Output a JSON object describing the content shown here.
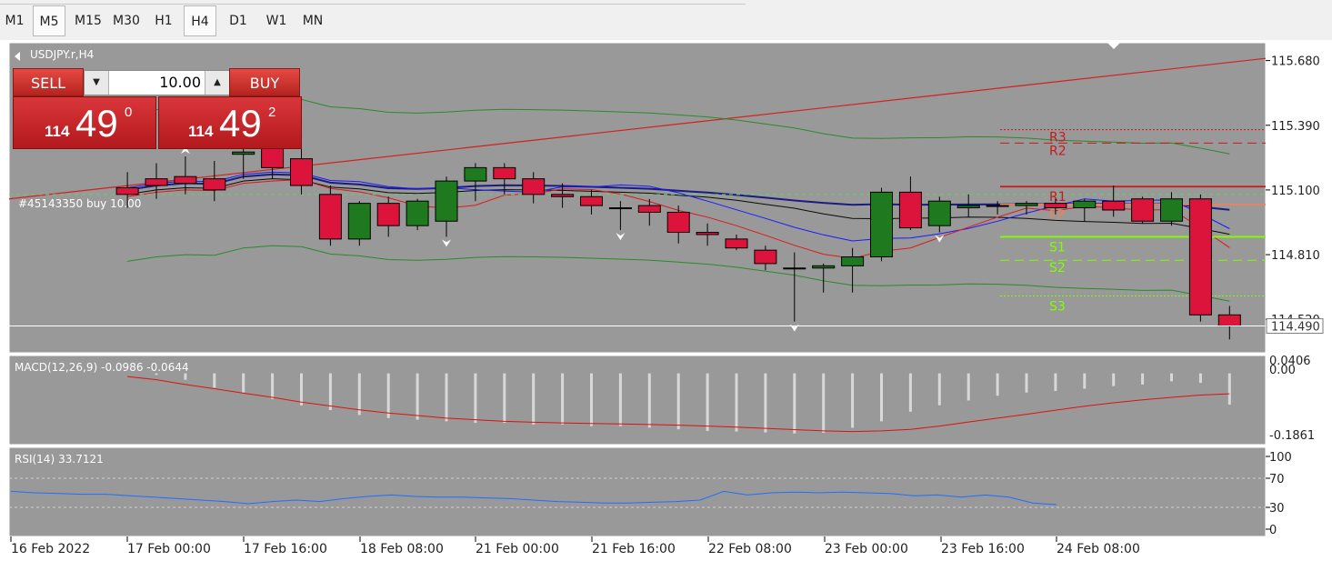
{
  "timeframes": [
    "M1",
    "M5",
    "M15",
    "M30",
    "H1",
    "H4",
    "D1",
    "W1",
    "MN"
  ],
  "selected_timeframes": [
    "M5",
    "H4"
  ],
  "symbol_label": "USDJPY.r,H4",
  "trade_panel": {
    "sell_label": "SELL",
    "buy_label": "BUY",
    "lot_value": "10.00",
    "sell_price_small": "114",
    "sell_price_big": "49",
    "sell_price_sup": "0",
    "buy_price_small": "114",
    "buy_price_big": "49",
    "buy_price_sup": "2"
  },
  "order_label": "#45143350 buy 10.00",
  "pivot_labels": [
    "R3",
    "R2",
    "R1",
    "PP",
    "S1",
    "S2",
    "S3"
  ],
  "colors": {
    "chart_bg": "#999999",
    "bull": "#1f7a1f",
    "bear": "#dc143c",
    "trendline": "#d42020",
    "pivot_r": "#c8191e",
    "pivot_pp": "#f08060",
    "pivot_s": "#7fff00",
    "ma_fast": "#e01818",
    "ma_mid": "#1a1aff",
    "ma_slow": "#0a0a0a",
    "ma_long": "#1c1c80",
    "bands": "#2a8a2a",
    "macd_signal": "#dd1111",
    "rsi_line": "#1e6fff"
  },
  "chart_data": [
    {
      "type": "candlestick",
      "symbol": "USDJPY.r",
      "timeframe": "H4",
      "price_axis": {
        "ticks": [
          "115.680",
          "115.390",
          "115.100",
          "114.810",
          "114.520"
        ],
        "current_price": "114.490",
        "ylim": [
          114.37,
          115.76
        ]
      },
      "time_labels": [
        "16 Feb 2022",
        "17 Feb 00:00",
        "17 Feb 16:00",
        "18 Feb 08:00",
        "21 Feb 00:00",
        "21 Feb 16:00",
        "22 Feb 08:00",
        "23 Feb 00:00",
        "23 Feb 16:00",
        "24 Feb 08:00"
      ],
      "candles": [
        {
          "o": 115.11,
          "h": 115.18,
          "l": 115.02,
          "c": 115.08
        },
        {
          "o": 115.15,
          "h": 115.22,
          "l": 115.06,
          "c": 115.12
        },
        {
          "o": 115.16,
          "h": 115.25,
          "l": 115.08,
          "c": 115.13
        },
        {
          "o": 115.15,
          "h": 115.23,
          "l": 115.05,
          "c": 115.1
        },
        {
          "o": 115.26,
          "h": 115.33,
          "l": 115.15,
          "c": 115.27
        },
        {
          "o": 115.29,
          "h": 115.36,
          "l": 115.15,
          "c": 115.2
        },
        {
          "o": 115.24,
          "h": 115.29,
          "l": 115.08,
          "c": 115.12
        },
        {
          "o": 115.08,
          "h": 115.12,
          "l": 114.85,
          "c": 114.88
        },
        {
          "o": 114.88,
          "h": 115.05,
          "l": 114.85,
          "c": 115.04
        },
        {
          "o": 115.04,
          "h": 115.07,
          "l": 114.89,
          "c": 114.94
        },
        {
          "o": 114.94,
          "h": 115.06,
          "l": 114.92,
          "c": 115.05
        },
        {
          "o": 114.96,
          "h": 115.16,
          "l": 114.89,
          "c": 115.14
        },
        {
          "o": 115.14,
          "h": 115.22,
          "l": 115.05,
          "c": 115.2
        },
        {
          "o": 115.2,
          "h": 115.22,
          "l": 115.08,
          "c": 115.15
        },
        {
          "o": 115.15,
          "h": 115.18,
          "l": 115.04,
          "c": 115.08
        },
        {
          "o": 115.08,
          "h": 115.13,
          "l": 115.02,
          "c": 115.07
        },
        {
          "o": 115.07,
          "h": 115.1,
          "l": 114.99,
          "c": 115.03
        },
        {
          "o": 115.02,
          "h": 115.05,
          "l": 114.92,
          "c": 115.02
        },
        {
          "o": 115.03,
          "h": 115.06,
          "l": 114.94,
          "c": 115.0
        },
        {
          "o": 115.0,
          "h": 115.03,
          "l": 114.86,
          "c": 114.91
        },
        {
          "o": 114.91,
          "h": 114.95,
          "l": 114.85,
          "c": 114.9
        },
        {
          "o": 114.88,
          "h": 114.9,
          "l": 114.83,
          "c": 114.84
        },
        {
          "o": 114.83,
          "h": 114.85,
          "l": 114.74,
          "c": 114.77
        },
        {
          "o": 114.75,
          "h": 114.82,
          "l": 114.51,
          "c": 114.75
        },
        {
          "o": 114.75,
          "h": 114.77,
          "l": 114.64,
          "c": 114.76
        },
        {
          "o": 114.76,
          "h": 114.84,
          "l": 114.64,
          "c": 114.8
        },
        {
          "o": 114.8,
          "h": 115.11,
          "l": 114.78,
          "c": 115.09
        },
        {
          "o": 115.09,
          "h": 115.16,
          "l": 114.92,
          "c": 114.93
        },
        {
          "o": 114.94,
          "h": 115.07,
          "l": 114.91,
          "c": 115.05
        },
        {
          "o": 115.02,
          "h": 115.08,
          "l": 114.98,
          "c": 115.03
        },
        {
          "o": 115.03,
          "h": 115.05,
          "l": 114.99,
          "c": 115.03
        },
        {
          "o": 115.03,
          "h": 115.05,
          "l": 114.99,
          "c": 115.04
        },
        {
          "o": 115.04,
          "h": 115.06,
          "l": 114.99,
          "c": 115.02
        },
        {
          "o": 115.02,
          "h": 115.06,
          "l": 114.96,
          "c": 115.05
        },
        {
          "o": 115.05,
          "h": 115.12,
          "l": 114.98,
          "c": 115.01
        },
        {
          "o": 115.06,
          "h": 115.07,
          "l": 114.95,
          "c": 114.96
        },
        {
          "o": 114.96,
          "h": 115.09,
          "l": 114.94,
          "c": 115.06
        },
        {
          "o": 115.06,
          "h": 115.08,
          "l": 114.51,
          "c": 114.54
        },
        {
          "o": 114.54,
          "h": 114.58,
          "l": 114.43,
          "c": 114.49
        }
      ],
      "pivots": {
        "R3": 115.37,
        "R2": 115.31,
        "R1": 115.115,
        "PP": 115.035,
        "S1": 114.89,
        "S2": 114.785,
        "S3": 114.625
      },
      "order_line": 115.08
    },
    {
      "type": "bar",
      "indicator": "MACD(12,26,9)",
      "values_label": "-0.0986 -0.0644",
      "axis_ticks": [
        "0.00",
        "0.0406",
        "-0.1861"
      ],
      "ylim": [
        -0.22,
        0.05
      ],
      "histogram": [
        0.0,
        -0.005,
        -0.02,
        -0.045,
        -0.06,
        -0.08,
        -0.1,
        -0.115,
        -0.13,
        -0.14,
        -0.145,
        -0.15,
        -0.155,
        -0.155,
        -0.16,
        -0.16,
        -0.165,
        -0.165,
        -0.17,
        -0.175,
        -0.18,
        -0.182,
        -0.185,
        -0.188,
        -0.186,
        -0.17,
        -0.15,
        -0.12,
        -0.1,
        -0.085,
        -0.07,
        -0.06,
        -0.055,
        -0.048,
        -0.04,
        -0.035,
        -0.025,
        -0.03,
        -0.098
      ],
      "signal": [
        -0.01,
        -0.02,
        -0.035,
        -0.048,
        -0.062,
        -0.075,
        -0.09,
        -0.102,
        -0.114,
        -0.124,
        -0.132,
        -0.14,
        -0.145,
        -0.15,
        -0.153,
        -0.155,
        -0.157,
        -0.158,
        -0.16,
        -0.162,
        -0.165,
        -0.168,
        -0.172,
        -0.176,
        -0.18,
        -0.182,
        -0.18,
        -0.175,
        -0.165,
        -0.152,
        -0.14,
        -0.128,
        -0.115,
        -0.103,
        -0.092,
        -0.083,
        -0.075,
        -0.068,
        -0.064
      ]
    },
    {
      "type": "line",
      "indicator": "RSI(14)",
      "value_label": "33.7121",
      "axis_ticks": [
        "100",
        "70",
        "30",
        "0"
      ],
      "ylim": [
        0,
        100
      ],
      "levels": [
        70,
        30
      ],
      "values": [
        52,
        50,
        49,
        48,
        48,
        46,
        44,
        42,
        40,
        38,
        35,
        38,
        40,
        38,
        42,
        45,
        47,
        45,
        44,
        44,
        43,
        42,
        40,
        38,
        37,
        36,
        36,
        37,
        38,
        40,
        52,
        47,
        50,
        51,
        50,
        51,
        50,
        49,
        46,
        47,
        44,
        47,
        44,
        36,
        33.7
      ]
    }
  ]
}
